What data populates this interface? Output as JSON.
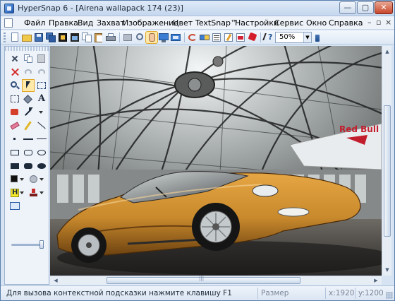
{
  "window": {
    "title": "HyperSnap 6 - [Airena wallapack 174 (23)]",
    "min_label": "—",
    "max_label": "▢",
    "close_label": "✕"
  },
  "menu": {
    "items": [
      "Файл",
      "Правка",
      "Вид",
      "Захват",
      "Изображение",
      "Цвет",
      "TextSnap™",
      "Настройки",
      "Сервис",
      "Окно",
      "Справка"
    ],
    "mdi_minimize": "–",
    "mdi_restore": "▫",
    "mdi_close": "×"
  },
  "toolbar": {
    "zoom_value": "50%",
    "zoom_arrow": "▼"
  },
  "status": {
    "hint": "Для вызова контекстной подсказки нажмите клавишу F1",
    "image_size_label": "Размер изображения:",
    "x_value": "x:1920",
    "y_value": "y:1200"
  },
  "colors": {
    "accent": "#e3a82a",
    "frame": "#d6e3f3",
    "car_body": "#c8892c"
  }
}
